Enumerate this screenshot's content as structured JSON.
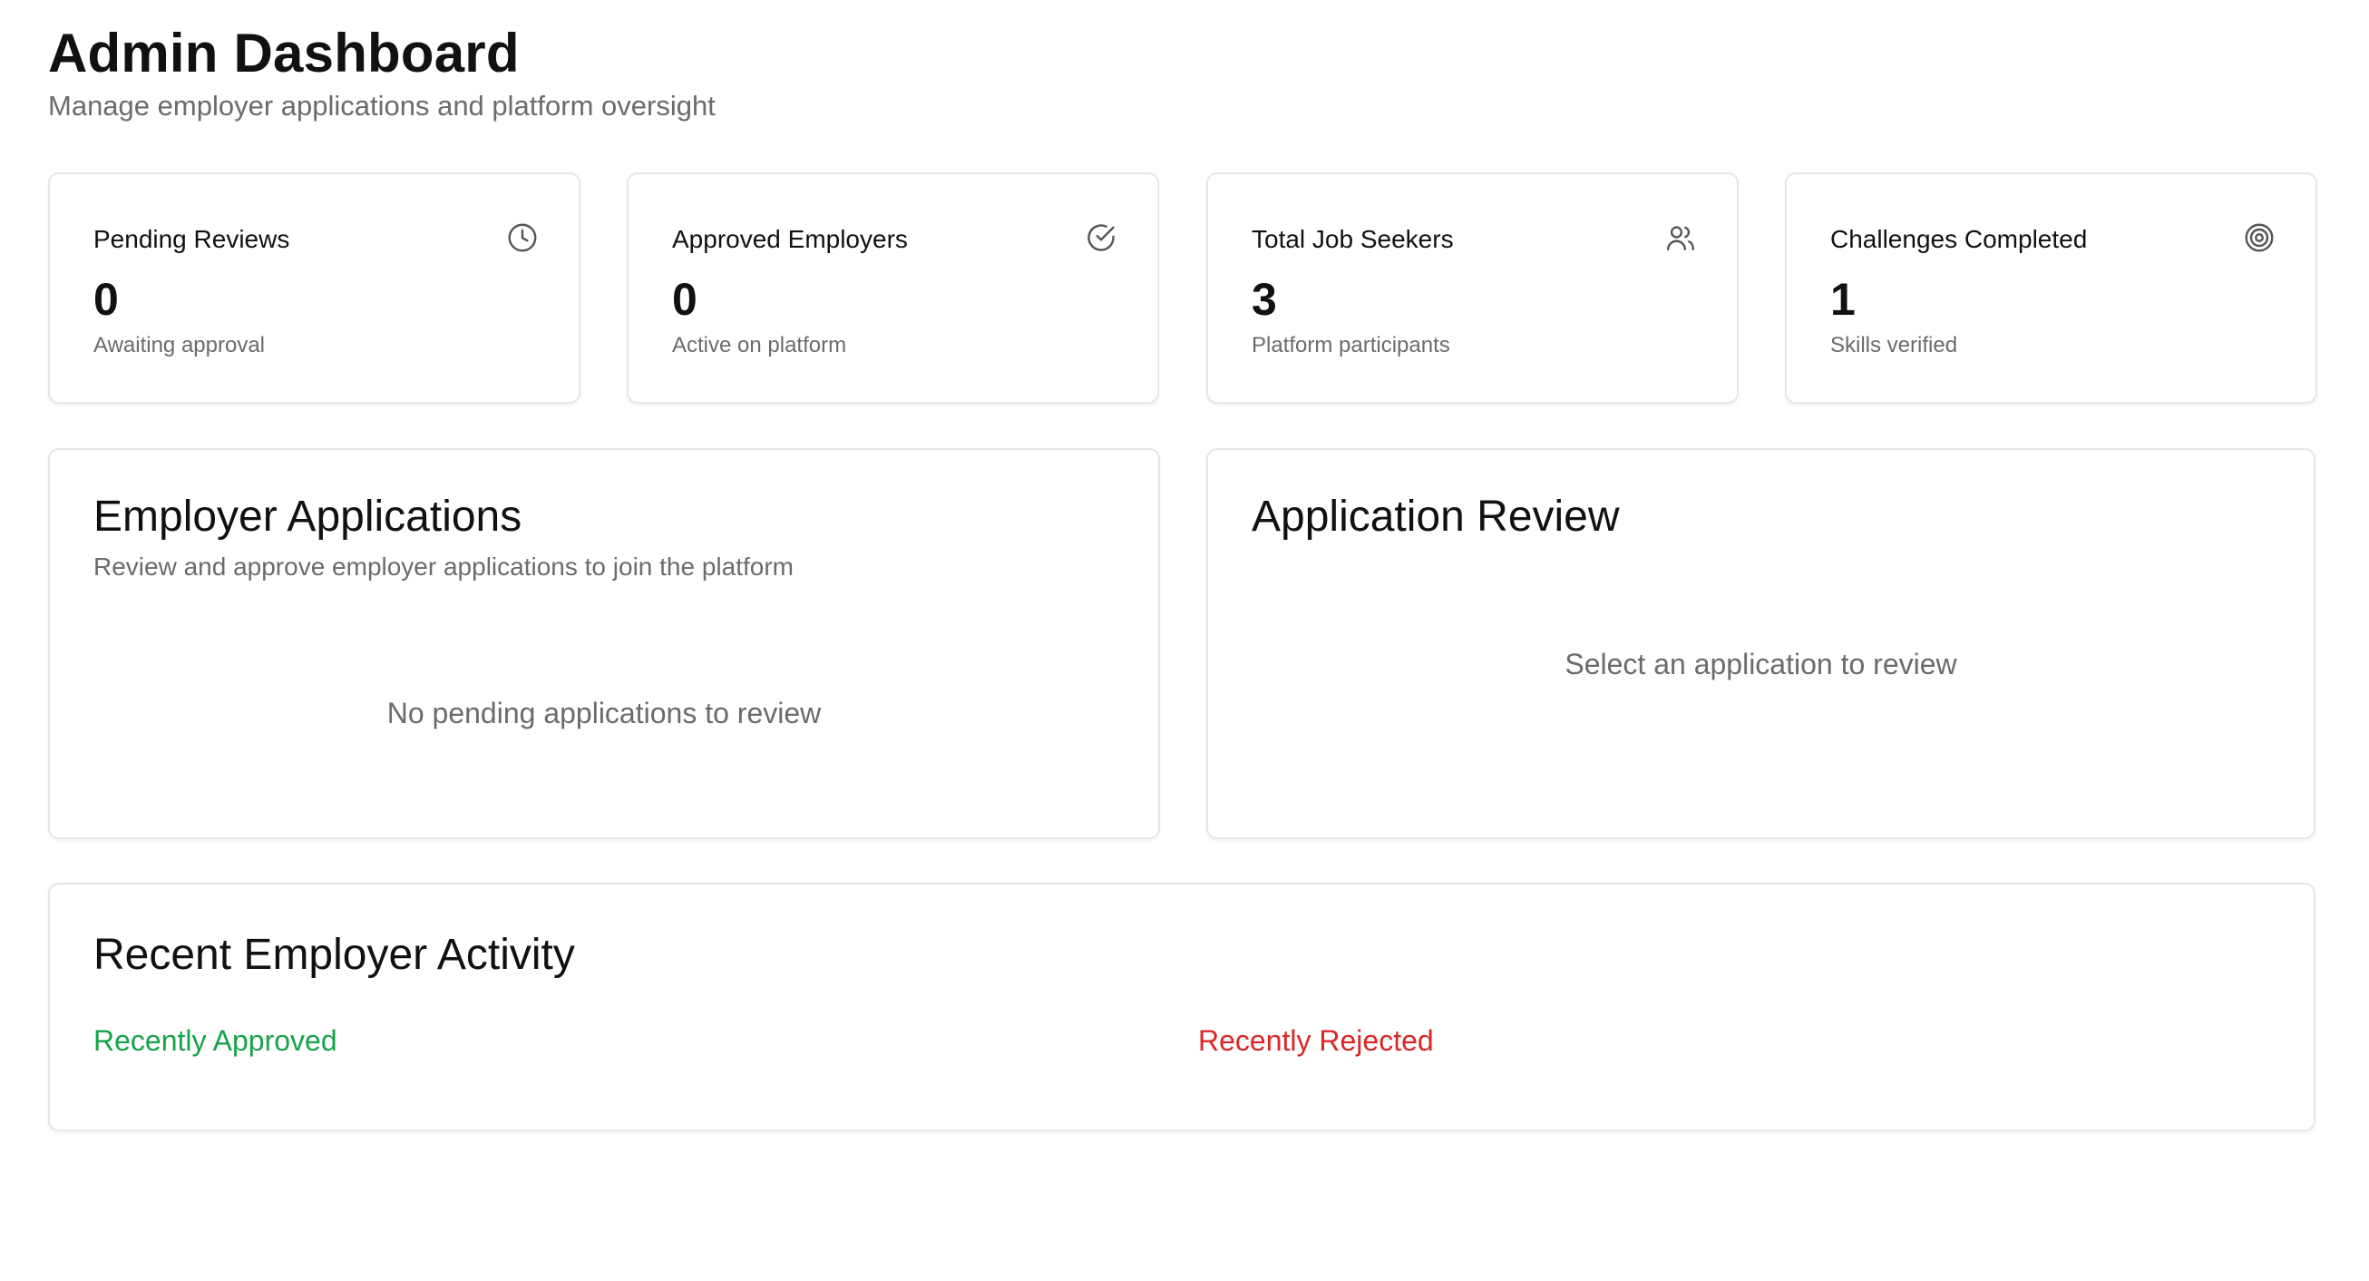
{
  "header": {
    "title": "Admin Dashboard",
    "subtitle": "Manage employer applications and platform oversight"
  },
  "stats": [
    {
      "label": "Pending Reviews",
      "value": "0",
      "description": "Awaiting approval",
      "icon": "clock-icon"
    },
    {
      "label": "Approved Employers",
      "value": "0",
      "description": "Active on platform",
      "icon": "check-circle-icon"
    },
    {
      "label": "Total Job Seekers",
      "value": "3",
      "description": "Platform participants",
      "icon": "users-icon"
    },
    {
      "label": "Challenges Completed",
      "value": "1",
      "description": "Skills verified",
      "icon": "target-icon"
    }
  ],
  "employer_applications": {
    "title": "Employer Applications",
    "description": "Review and approve employer applications to join the platform",
    "empty_message": "No pending applications to review"
  },
  "application_review": {
    "title": "Application Review",
    "empty_message": "Select an application to review"
  },
  "recent_activity": {
    "title": "Recent Employer Activity",
    "approved_label": "Recently Approved",
    "rejected_label": "Recently Rejected"
  },
  "colors": {
    "approved": "#16a34a",
    "rejected": "#dc2626",
    "muted_text": "#6b6b6b",
    "border": "#e6e6e6"
  }
}
